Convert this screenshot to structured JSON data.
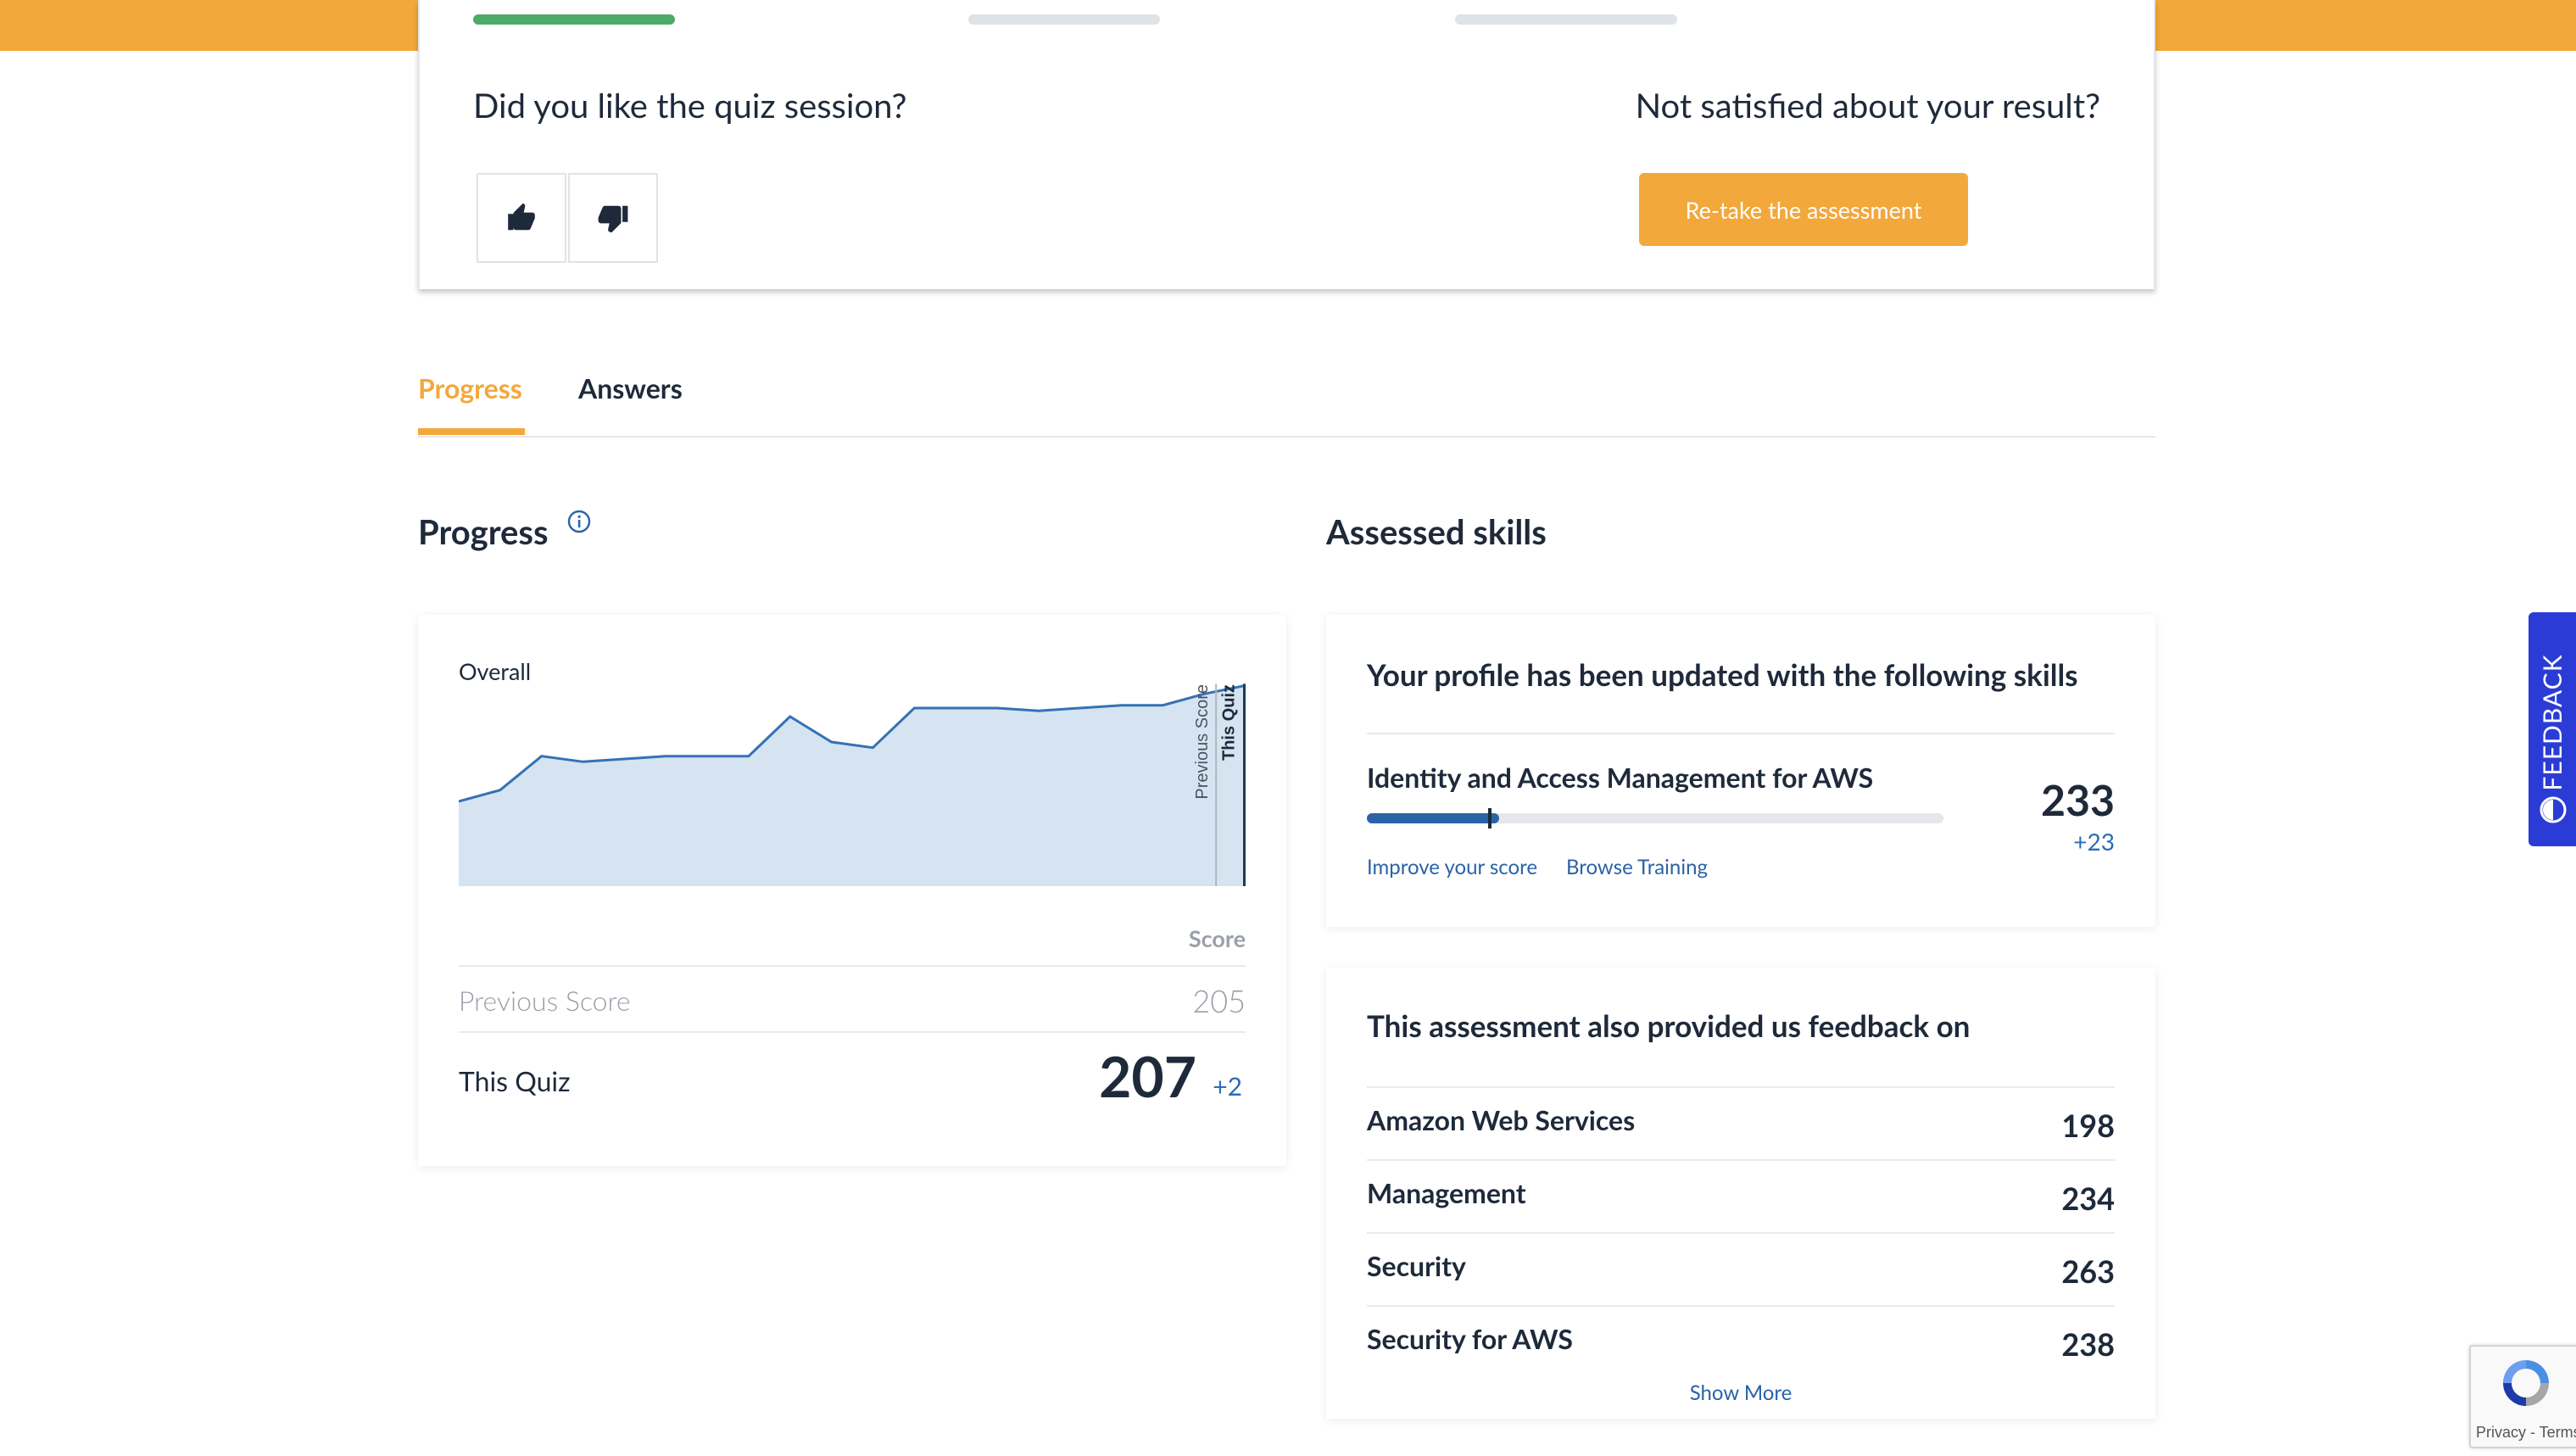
{
  "colors": {
    "accent_orange": "#f3a83b",
    "step_done_green": "#4caa67",
    "link_blue": "#2a63a8",
    "feedback_blue": "#2b3cd6",
    "chart_line": "#3572b5",
    "chart_fill": "#d6e4f2"
  },
  "session": {
    "steps": [
      {
        "state": "complete"
      },
      {
        "state": "pending"
      },
      {
        "state": "pending"
      }
    ],
    "like_question": "Did you like the quiz session?",
    "thumbs_up_icon": "thumbs-up-icon",
    "thumbs_down_icon": "thumbs-down-icon",
    "not_satisfied_question": "Not satisfied about your result?",
    "retake_label": "Re-take the assessment"
  },
  "tabs": [
    {
      "label": "Progress",
      "active": true
    },
    {
      "label": "Answers",
      "active": false
    }
  ],
  "progress": {
    "title": "Progress",
    "info_icon": "info-icon",
    "chart_data": {
      "type": "area",
      "title": "Overall",
      "xlabel": "",
      "ylabel": "",
      "grid": false,
      "values": [
        166,
        170,
        182,
        180,
        181,
        182,
        182,
        182,
        196,
        187,
        185,
        199,
        199,
        199,
        198,
        199,
        200,
        200,
        204,
        207
      ],
      "ylim": [
        136,
        208
      ],
      "markers": [
        "Previous Score",
        "This Quiz"
      ]
    },
    "score_header": "Score",
    "previous_label": "Previous Score",
    "previous_value": "205",
    "this_label": "This Quiz",
    "this_value": "207",
    "this_delta": "+2"
  },
  "assessed": {
    "title": "Assessed skills",
    "profile_heading": "Your profile has been updated with the following skills",
    "skill": {
      "name": "Identity and Access Management for AWS",
      "score": "233",
      "delta": "+23",
      "bar_fill_fraction": 0.23,
      "bar_marker_fraction": 0.21,
      "improve_link": "Improve your score",
      "browse_link": "Browse Training"
    },
    "feedback_heading": "This assessment also provided us feedback on",
    "feedback_items": [
      {
        "name": "Amazon Web Services",
        "score": "198"
      },
      {
        "name": "Management",
        "score": "234"
      },
      {
        "name": "Security",
        "score": "263"
      },
      {
        "name": "Security for AWS",
        "score": "238"
      }
    ],
    "show_more": "Show More"
  },
  "feedback_tab": {
    "label": "FEEDBACK",
    "icon": "feedback-circle-icon"
  },
  "recaptcha": {
    "text": "Privacy - Terms",
    "icon": "recaptcha-icon"
  }
}
